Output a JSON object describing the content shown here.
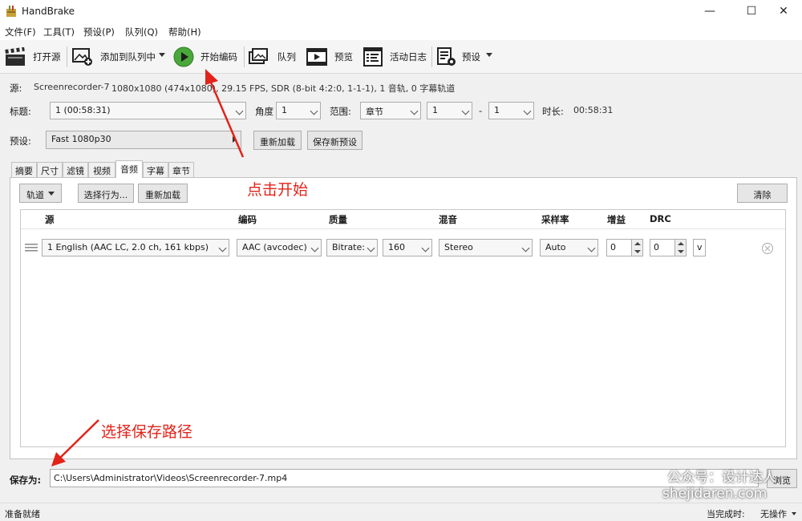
{
  "window": {
    "title": "HandBrake",
    "controls": [
      "—",
      "☐",
      "✕"
    ]
  },
  "menu": [
    "文件(F)",
    "工具(T)",
    "预设(P)",
    "队列(Q)",
    "帮助(H)"
  ],
  "toolbar": {
    "open_source": "打开源",
    "add_to_queue": "添加到队列中",
    "start_encode": "开始编码",
    "queue": "队列",
    "preview": "预览",
    "activity_log": "活动日志",
    "presets": "预设"
  },
  "source": {
    "label": "源:",
    "name": "Screenrecorder-7",
    "info": "1080x1080 (474x1080), 29.15 FPS, SDR (8-bit 4:2:0, 1-1-1), 1 音轨, 0 字幕轨道"
  },
  "title_row": {
    "title_label": "标题:",
    "title_value": "1  (00:58:31)",
    "angle_label": "角度",
    "angle_value": "1",
    "range_label": "范围:",
    "range_type": "章节",
    "range_start": "1",
    "range_sep": "-",
    "range_end": "1",
    "duration_label": "时长:",
    "duration_value": "00:58:31"
  },
  "preset_row": {
    "label": "预设:",
    "value": "Fast 1080p30",
    "reload": "重新加载",
    "save_new": "保存新预设"
  },
  "tabs": [
    "摘要",
    "尺寸",
    "滤镜",
    "视频",
    "音频",
    "字幕",
    "章节"
  ],
  "active_tab": "音频",
  "audio": {
    "tracks_btn": "轨道",
    "choose_behavior": "选择行为...",
    "reload": "重新加载",
    "clear": "清除",
    "headers": [
      "源",
      "编码",
      "质量",
      "混音",
      "采样率",
      "增益",
      "DRC"
    ],
    "row": {
      "source": "1 English (AAC LC, 2.0 ch, 161 kbps)",
      "codec": "AAC (avcodec)",
      "quality_mode": "Bitrate:",
      "bitrate": "160",
      "mixdown": "Stereo",
      "samplerate": "Auto",
      "gain": "0",
      "drc": "0",
      "small": "v"
    }
  },
  "save": {
    "label": "保存为:",
    "path": "C:\\Users\\Administrator\\Videos\\Screenrecorder-7.mp4",
    "browse": "浏览"
  },
  "status": {
    "text": "准备就绪",
    "when_done_label": "当完成时:",
    "when_done_value": "无操作"
  },
  "annotations": {
    "click_start": "点击开始",
    "choose_path": "选择保存路径",
    "color": "#e2231a"
  },
  "watermark": {
    "line1": "公众号：设计达人",
    "line2": "shejidaren.com"
  }
}
